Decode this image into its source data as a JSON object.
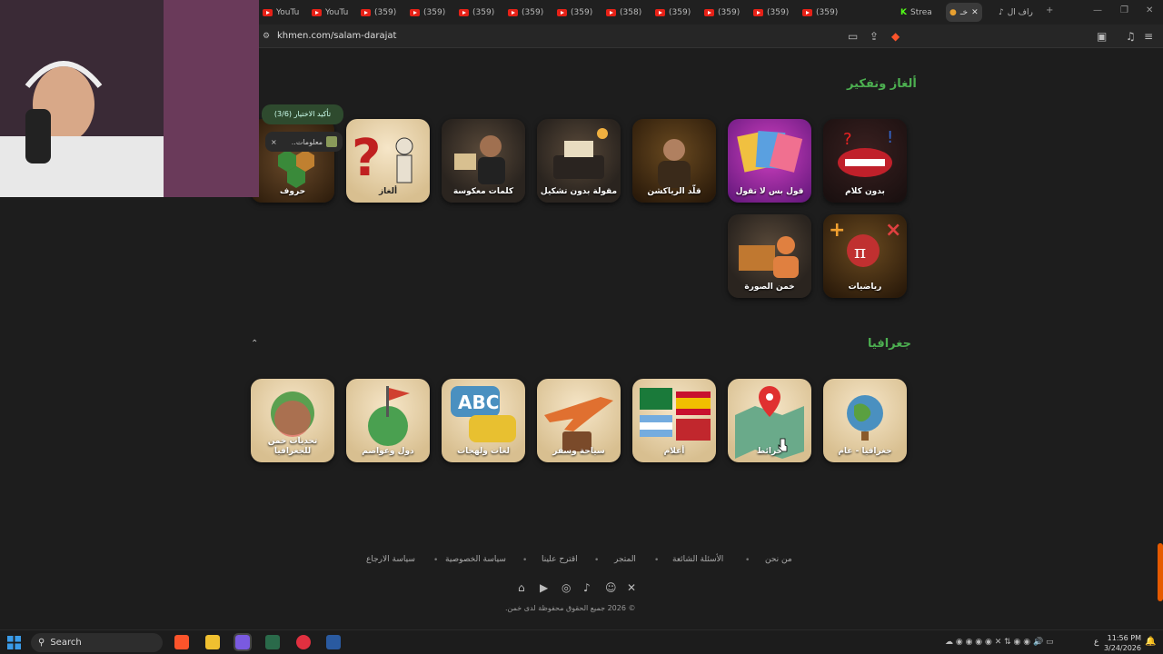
{
  "browser": {
    "tabs": [
      {
        "label": "YouTu",
        "kind": "youtube"
      },
      {
        "label": "YouTu",
        "kind": "youtube"
      },
      {
        "label": "(359)",
        "kind": "youtube"
      },
      {
        "label": "(359)",
        "kind": "youtube"
      },
      {
        "label": "(359)",
        "kind": "youtube"
      },
      {
        "label": "(359)",
        "kind": "youtube"
      },
      {
        "label": "(359)",
        "kind": "youtube"
      },
      {
        "label": "(358)",
        "kind": "youtube"
      },
      {
        "label": "(359)",
        "kind": "youtube"
      },
      {
        "label": "(359)",
        "kind": "youtube"
      },
      {
        "label": "(359)",
        "kind": "youtube"
      },
      {
        "label": "(359)",
        "kind": "youtube"
      },
      {
        "label": "Strea",
        "kind": "kick"
      },
      {
        "label": "خـ",
        "kind": "site",
        "active": true
      },
      {
        "label": "راف ال",
        "kind": "tiktok"
      }
    ],
    "new_tab": "+",
    "url": "khmen.com/salam-darajat"
  },
  "sections": {
    "puzzles": {
      "title": "ألغاز وتفكير",
      "cards": [
        {
          "label": "بدون كلام"
        },
        {
          "label": "قول بس لا تقول"
        },
        {
          "label": "قلّد الرياكشن"
        },
        {
          "label": "مقولة بدون تشكيل"
        },
        {
          "label": "كلمات معكوسة"
        },
        {
          "label": "ألغاز"
        },
        {
          "label": "حروف"
        },
        {
          "label": "رياضيات"
        },
        {
          "label": "خمن الصورة"
        }
      ]
    },
    "geography": {
      "title": "جغرافيا",
      "cards": [
        {
          "label": "جغرافيا - عام"
        },
        {
          "label": "خرائط"
        },
        {
          "label": "أعلام"
        },
        {
          "label": "سياحة وسفر"
        },
        {
          "label": "لغات ولهجات"
        },
        {
          "label": "دول وعواصم"
        },
        {
          "label": "تحديات خمن للجغرافيا"
        }
      ]
    }
  },
  "overlay": {
    "confirm": "تأكيد الاختيار (3/6)",
    "info": "معلومات..",
    "close": "×"
  },
  "collapse_chevron": "⌃",
  "footer": {
    "links": [
      "من نحن",
      "الأسئلة الشائعة",
      "المتجر",
      "اقترح علينا",
      "سياسة الخصوصية",
      "سياسة الارجاع"
    ],
    "copyright": "© 2026 جميع الحقوق محفوظة لدى خمن."
  },
  "taskbar": {
    "search_placeholder": "Search",
    "time": "11:56 PM",
    "date": "3/24/2026",
    "lang": "ع"
  },
  "colors": {
    "accent_green": "#4caf50",
    "youtube_red": "#e62117",
    "scroll_orange": "#e65a00"
  }
}
